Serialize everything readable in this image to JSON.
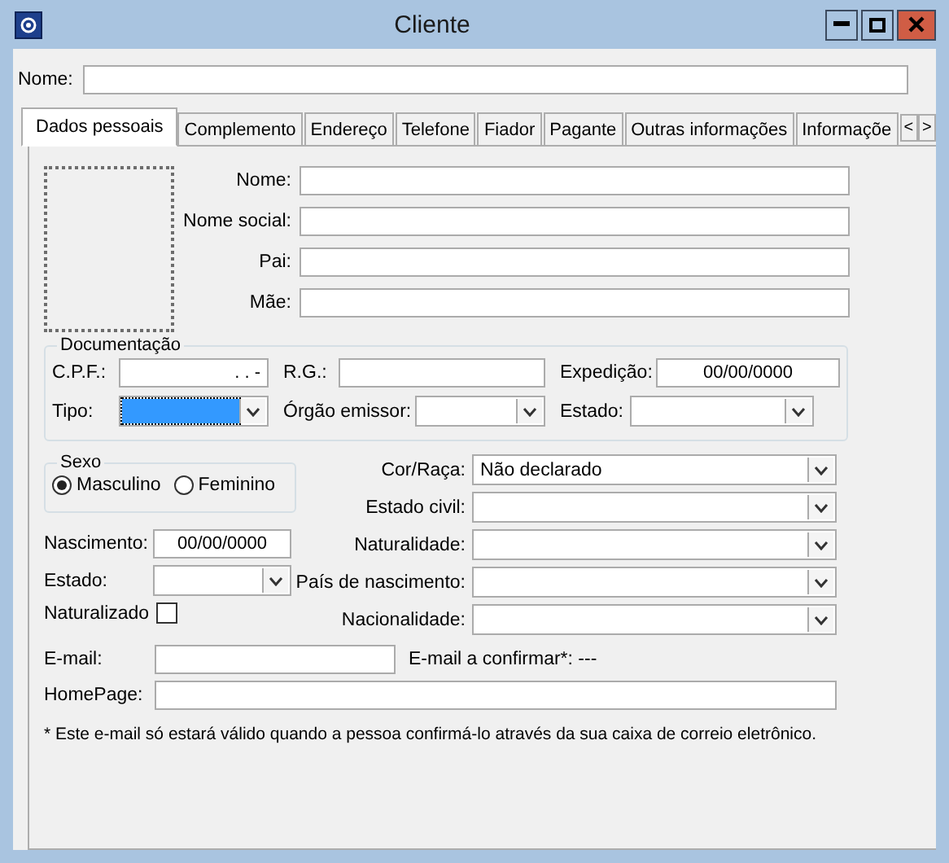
{
  "window": {
    "title": "Cliente"
  },
  "name_field": {
    "label": "Nome:"
  },
  "tabs": [
    {
      "label": "Dados pessoais",
      "selected": true
    },
    {
      "label": "Complemento",
      "selected": false
    },
    {
      "label": "Endereço",
      "selected": false
    },
    {
      "label": "Telefone",
      "selected": false
    },
    {
      "label": "Fiador",
      "selected": false
    },
    {
      "label": "Pagante",
      "selected": false
    },
    {
      "label": "Outras informações",
      "selected": false
    },
    {
      "label": "Informaçõe",
      "selected": false
    }
  ],
  "tab_scroll": [
    "<",
    ">"
  ],
  "personal_fields": [
    {
      "label": "Nome:"
    },
    {
      "label": "Nome social:"
    },
    {
      "label": "Pai:"
    },
    {
      "label": "Mãe:"
    }
  ],
  "documentation": {
    "title": "Documentação",
    "rows": [
      [
        {
          "label": "C.P.F.:",
          "kind": "text",
          "value": ". . -",
          "focused": false
        },
        {
          "label": "R.G.:",
          "kind": "text",
          "focused": false
        },
        {
          "label": "Expedição:",
          "kind": "date",
          "value": "00/00/0000",
          "focused": false
        }
      ],
      [
        {
          "label": "Tipo:",
          "kind": "combo",
          "focused": true
        },
        {
          "label": "Órgão emissor:",
          "kind": "combo",
          "focused": false
        },
        {
          "label": "Estado:",
          "kind": "combo",
          "focused": false
        }
      ]
    ]
  },
  "sex": {
    "title": "Sexo",
    "options": [
      {
        "label": "Masculino",
        "selected": true
      },
      {
        "label": "Feminino",
        "selected": false
      }
    ]
  },
  "right_fields": [
    {
      "label": "Cor/Raça:",
      "value": "Não declarado"
    },
    {
      "label": "Estado civil:"
    },
    {
      "label": "Naturalidade:"
    },
    {
      "label": "País de nascimento:"
    },
    {
      "label": "Nacionalidade:"
    }
  ],
  "left_fields": [
    {
      "label": "Nascimento:",
      "kind": "date",
      "value": "00/00/0000"
    },
    {
      "label": "Estado:",
      "kind": "combo"
    },
    {
      "label": "Naturalizado",
      "kind": "checkbox",
      "checked": false
    }
  ],
  "email": {
    "label": "E-mail:",
    "confirm": "E-mail a confirmar*: ---"
  },
  "homepage": {
    "label": "HomePage:"
  },
  "note": "* Este e-mail só estará válido quando a pessoa confirmá-lo através da sua caixa de correio eletrônico."
}
